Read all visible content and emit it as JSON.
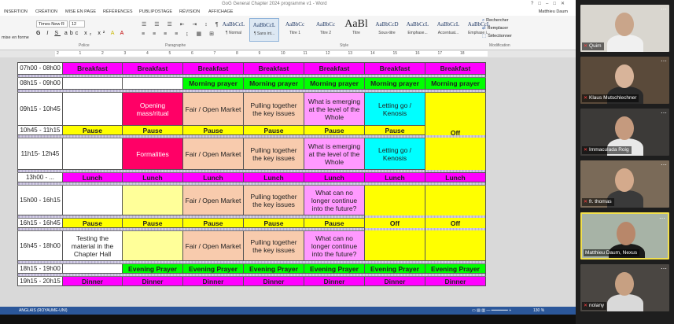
{
  "word": {
    "title": "GoG General Chapter 2024 programme v1 - Word",
    "user": "Matthieu Daum",
    "tabs": [
      "INSERTION",
      "CRÉATION",
      "MISE EN PAGE",
      "RÉFÉRENCES",
      "PUBLIPOSTAGE",
      "RÉVISION",
      "AFFICHAGE"
    ],
    "paste_label": "mise en forme",
    "font_name": "Times New R",
    "font_size": "12",
    "groups": {
      "font": "Police",
      "paragraph": "Paragraphe",
      "style": "Style",
      "modification": "Modification"
    },
    "styles": [
      {
        "sample": "AaBbCcL",
        "name": "¶ Normal"
      },
      {
        "sample": "AaBbCcL",
        "name": "¶ Sans int..."
      },
      {
        "sample": "AaBbCc",
        "name": "Titre 1"
      },
      {
        "sample": "AaBbCc",
        "name": "Titre 2"
      },
      {
        "sample": "AaBl",
        "name": "Titre"
      },
      {
        "sample": "AaBbCcD",
        "name": "Sous-titre"
      },
      {
        "sample": "AaBbCcL",
        "name": "Emphase..."
      },
      {
        "sample": "AaBbCcL",
        "name": "Accentuat..."
      },
      {
        "sample": "AaBbCcL",
        "name": "Emphase i..."
      }
    ],
    "edit": {
      "find": "Rechercher",
      "replace": "Remplacer",
      "select": "Sélectionner"
    },
    "ruler_numbers": [
      "2",
      "1",
      "2",
      "3",
      "4",
      "5",
      "6",
      "7",
      "8",
      "9",
      "10",
      "11",
      "12",
      "13",
      "14",
      "15",
      "16",
      "17",
      "18"
    ],
    "status": {
      "language": "ANGLAIS (ROYAUME-UNI)",
      "zoom": "130 %"
    }
  },
  "schedule": {
    "rows": [
      {
        "time": "07h00 - 08h00",
        "h": 15,
        "cells": [
          {
            "text": "Breakfast",
            "color": "magenta",
            "bold": true
          },
          {
            "text": "Breakfast",
            "color": "magenta",
            "bold": true
          },
          {
            "text": "Breakfast",
            "color": "magenta",
            "bold": true
          },
          {
            "text": "Breakfast",
            "color": "magenta",
            "bold": true
          },
          {
            "text": "Breakfast",
            "color": "magenta",
            "bold": true
          },
          {
            "text": "Breakfast",
            "color": "magenta",
            "bold": true
          },
          {
            "text": "Breakfast",
            "color": "magenta",
            "bold": true
          }
        ]
      },
      {
        "sep": true
      },
      {
        "time": "08h15 - 09h00",
        "h": 15,
        "cells": [
          {
            "text": "",
            "color": "white"
          },
          {
            "text": "",
            "color": "white"
          },
          {
            "text": "Morning prayer",
            "color": "green",
            "bold": true
          },
          {
            "text": "Morning prayer",
            "color": "green",
            "bold": true
          },
          {
            "text": "Morning prayer",
            "color": "green",
            "bold": true
          },
          {
            "text": "Morning prayer",
            "color": "green",
            "bold": true
          },
          {
            "text": "Morning prayer",
            "color": "green",
            "bold": true
          }
        ]
      },
      {
        "sep": true
      },
      {
        "time": "09h15 - 10h45",
        "h": 42,
        "cells": [
          {
            "text": "",
            "color": "white"
          },
          {
            "text": "Opening mass/ritual",
            "color": "pinkred"
          },
          {
            "text": "Fair / Open Market",
            "color": "peach"
          },
          {
            "text": "Pulling together the key issues",
            "color": "peach"
          },
          {
            "text": "What is emerging at the level of the Whole",
            "color": "lilac"
          },
          {
            "text": "Letting go / Kenosis",
            "color": "cyan"
          },
          {
            "text": "Off",
            "color": "yellow",
            "bold": true,
            "rowspan": 5
          }
        ]
      },
      {
        "time": "10h45 - 11h15",
        "h": 12,
        "cells": [
          {
            "text": "Pause",
            "color": "yellow",
            "bold": true
          },
          {
            "text": "Pause",
            "color": "yellow",
            "bold": true
          },
          {
            "text": "Pause",
            "color": "yellow",
            "bold": true
          },
          {
            "text": "Pause",
            "color": "yellow",
            "bold": true
          },
          {
            "text": "Pause",
            "color": "yellow",
            "bold": true
          },
          {
            "text": "Pause",
            "color": "yellow",
            "bold": true
          }
        ]
      },
      {
        "sep": true
      },
      {
        "time": "11h15- 12h45",
        "h": 40,
        "cells": [
          {
            "text": "",
            "color": "white"
          },
          {
            "text": "Formalities",
            "color": "pinkred"
          },
          {
            "text": "Fair / Open Market",
            "color": "peach"
          },
          {
            "text": "Pulling together the key issues",
            "color": "peach"
          },
          {
            "text": "What is emerging at the level of the Whole",
            "color": "lilac"
          },
          {
            "text": "Letting go / Kenosis",
            "color": "cyan"
          }
        ]
      },
      {
        "sep": true
      },
      {
        "time": "13h00 - ...",
        "h": 12,
        "cells": [
          {
            "text": "Lunch",
            "color": "magenta",
            "bold": true
          },
          {
            "text": "Lunch",
            "color": "magenta",
            "bold": true
          },
          {
            "text": "Lunch",
            "color": "magenta",
            "bold": true
          },
          {
            "text": "Lunch",
            "color": "magenta",
            "bold": true
          },
          {
            "text": "Lunch",
            "color": "magenta",
            "bold": true
          },
          {
            "text": "Lunch",
            "color": "magenta",
            "bold": true
          },
          {
            "text": "Lunch",
            "color": "magenta",
            "bold": true
          }
        ]
      },
      {
        "sep": true
      },
      {
        "time": "15h00 - 16h15",
        "h": 38,
        "cells": [
          {
            "text": "",
            "color": "white"
          },
          {
            "text": "",
            "color": "cream"
          },
          {
            "text": "Fair / Open Market",
            "color": "peach"
          },
          {
            "text": "Pulling together the key issues",
            "color": "peach"
          },
          {
            "text": "What can no longer continue into the future?",
            "color": "lilac"
          },
          {
            "text": "Off",
            "color": "yellow",
            "bold": true,
            "rowspan": 5
          },
          {
            "text": "Off",
            "color": "yellow",
            "bold": true,
            "rowspan": 5
          }
        ]
      },
      {
        "sep": true
      },
      {
        "time": "16h15 - 16h45",
        "h": 12,
        "cells": [
          {
            "text": "Pause",
            "color": "yellow",
            "bold": true
          },
          {
            "text": "Pause",
            "color": "yellow",
            "bold": true
          },
          {
            "text": "Pause",
            "color": "yellow",
            "bold": true
          },
          {
            "text": "Pause",
            "color": "yellow",
            "bold": true
          },
          {
            "text": "Pause",
            "color": "yellow",
            "bold": true
          }
        ]
      },
      {
        "sep": true
      },
      {
        "time": "16h45 - 18h00",
        "h": 38,
        "cells": [
          {
            "text": "Testing the material in the Chapter Hall",
            "color": "white"
          },
          {
            "text": "",
            "color": "cream"
          },
          {
            "text": "Fair / Open Market",
            "color": "peach"
          },
          {
            "text": "Pulling together the key issues",
            "color": "peach"
          },
          {
            "text": "What can no longer continue into the future?",
            "color": "lilac"
          }
        ]
      },
      {
        "sep": true
      },
      {
        "time": "18h15 - 19h00",
        "h": 12,
        "cells": [
          {
            "text": "",
            "color": "white"
          },
          {
            "text": "Evening Prayer",
            "color": "green",
            "bold": true
          },
          {
            "text": "Evening Prayer",
            "color": "green",
            "bold": true
          },
          {
            "text": "Evening Prayer",
            "color": "green",
            "bold": true
          },
          {
            "text": "Evening Prayer",
            "color": "green",
            "bold": true
          },
          {
            "text": "Evening Prayer",
            "color": "green",
            "bold": true
          },
          {
            "text": "Evening Prayer",
            "color": "green",
            "bold": true
          }
        ]
      },
      {
        "sep": true
      },
      {
        "time": "19h15 - 20h15",
        "h": 12,
        "cells": [
          {
            "text": "Dinner",
            "color": "magenta",
            "bold": true
          },
          {
            "text": "Dinner",
            "color": "magenta",
            "bold": true
          },
          {
            "text": "Dinner",
            "color": "magenta",
            "bold": true
          },
          {
            "text": "Dinner",
            "color": "magenta",
            "bold": true
          },
          {
            "text": "Dinner",
            "color": "magenta",
            "bold": true
          },
          {
            "text": "Dinner",
            "color": "magenta",
            "bold": true
          },
          {
            "text": "Dinner",
            "color": "magenta",
            "bold": true
          }
        ]
      }
    ]
  },
  "participants": [
    {
      "name": "Quim",
      "bg": "#d9d6cf",
      "skin": "#c9a58a",
      "shirt": "#f0f0f0",
      "active": false
    },
    {
      "name": "Klaus Mutschlechner",
      "bg": "#5a4a3a",
      "skin": "#d8b49a",
      "shirt": "#2a2a2a",
      "active": false
    },
    {
      "name": "Immaculada Roig",
      "bg": "#3c3a38",
      "skin": "#c59a7e",
      "shirt": "#e8e8e8",
      "active": false
    },
    {
      "name": "fr. thomas",
      "bg": "#7a6a58",
      "skin": "#d4aa8c",
      "shirt": "#3a3a3a",
      "active": false
    },
    {
      "name": "Matthieu Daum, Nexus",
      "bg": "#a7b3a6",
      "skin": "#b8876a",
      "shirt": "#1a1a1a",
      "active": true
    },
    {
      "name": "nolany",
      "bg": "#4a4642",
      "skin": "#c7a082",
      "shirt": "#d9d9d9",
      "active": false
    }
  ]
}
